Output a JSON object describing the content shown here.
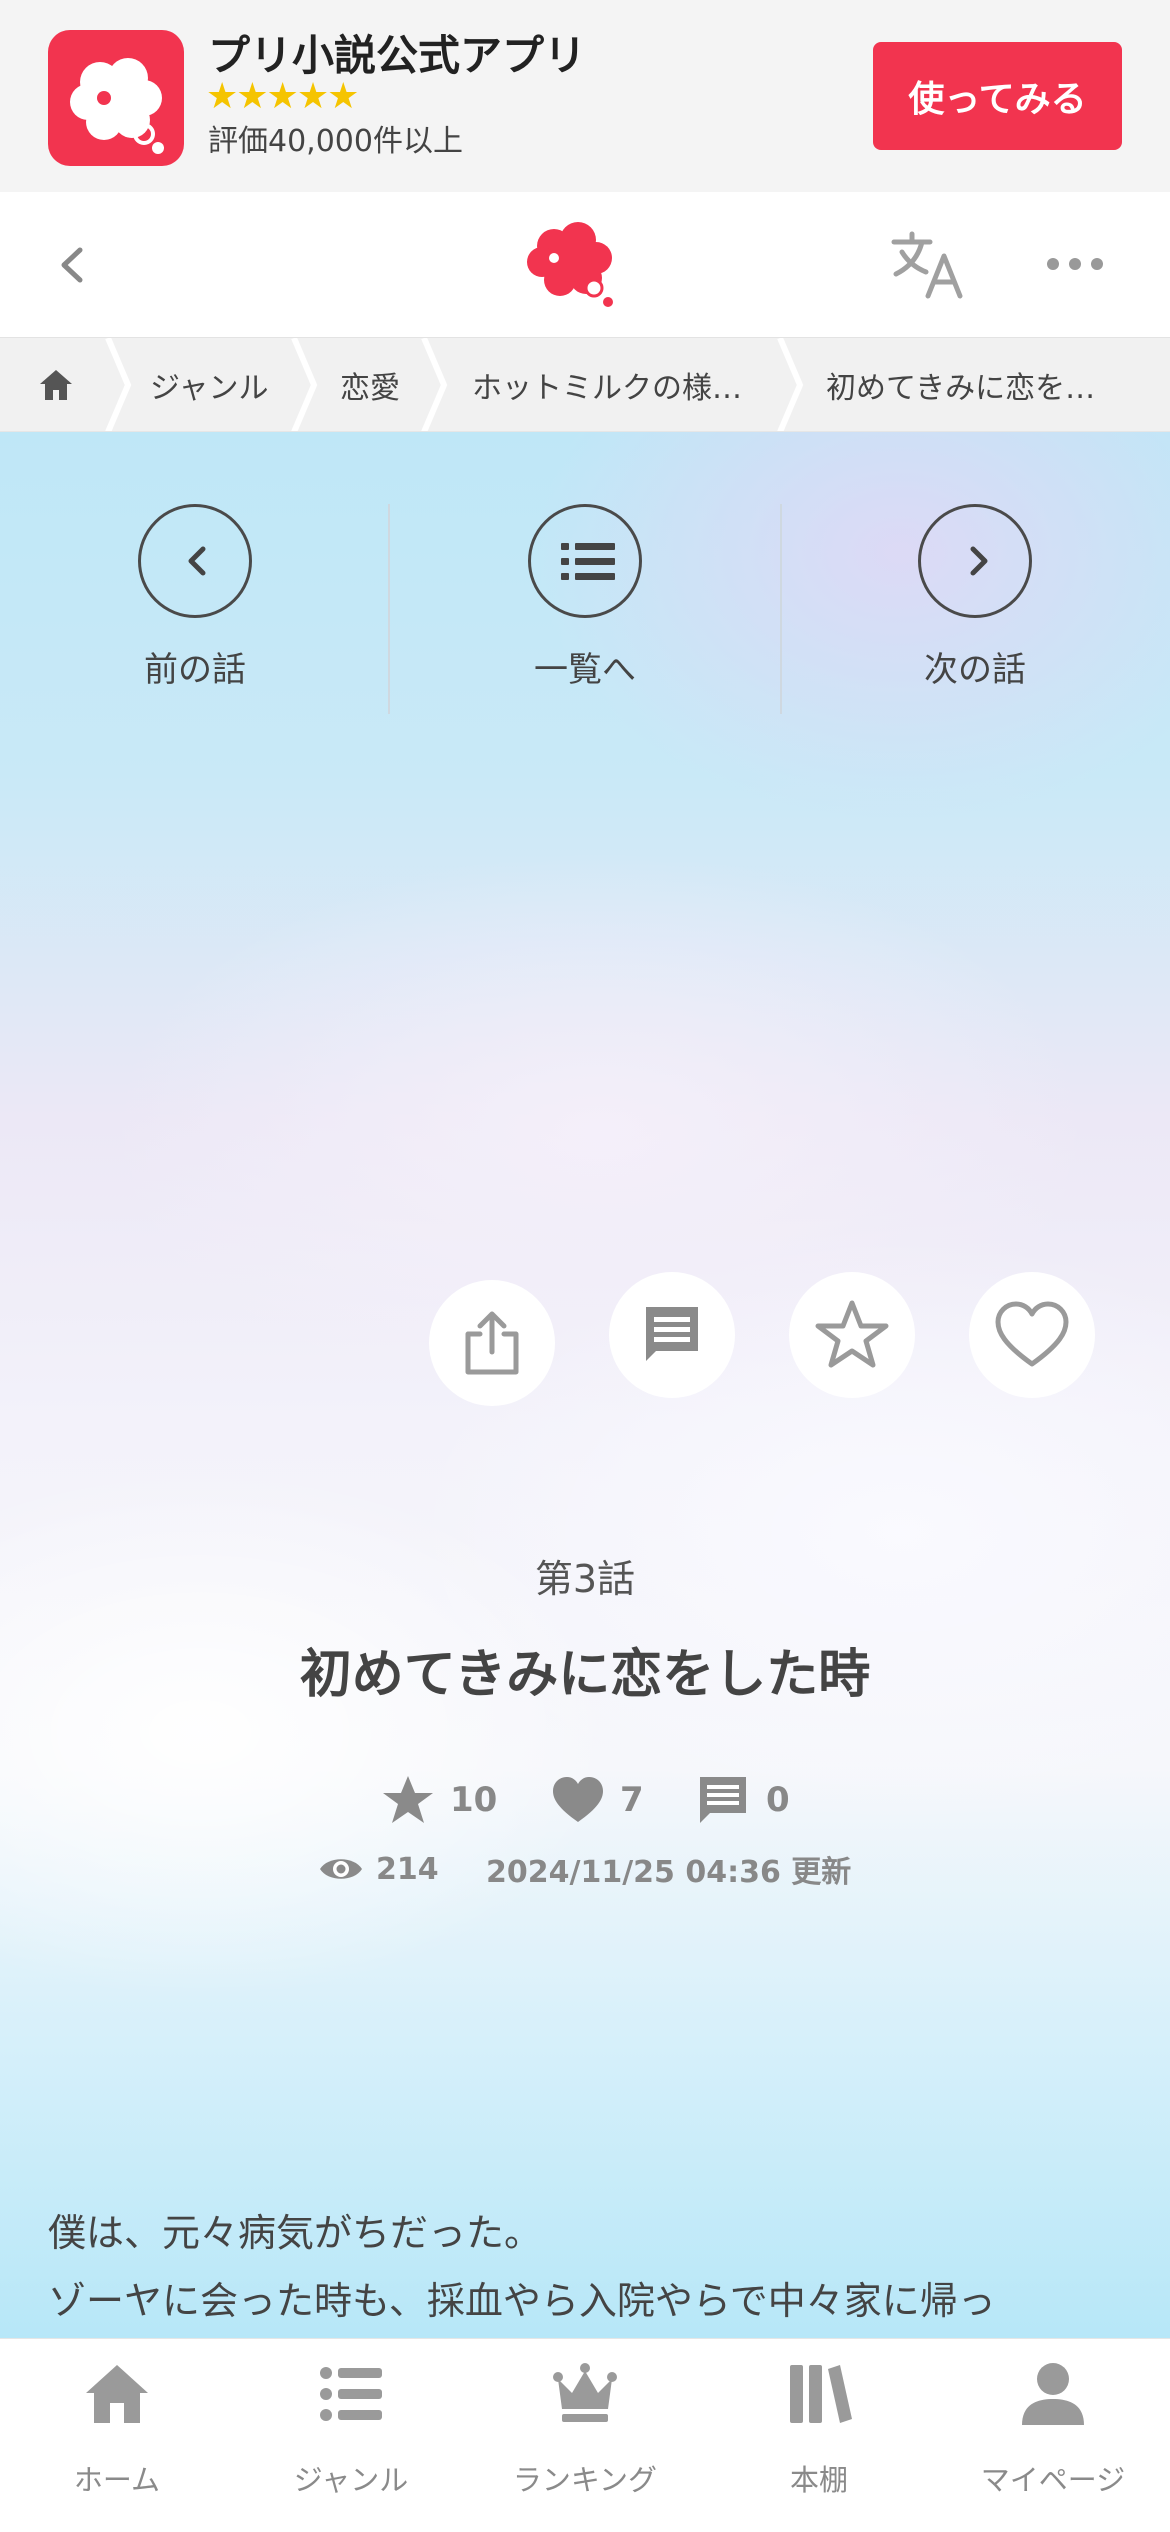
{
  "app_banner": {
    "title": "プリ小説公式アプリ",
    "stars": "★★★★★",
    "rating_text": "評価40,000件以上",
    "cta_label": "使ってみる",
    "accent_color": "#f2344f"
  },
  "header": {
    "back_icon": "chevron-left-icon",
    "logo_icon": "cloud-logo-icon",
    "translate_icon": "translate-icon",
    "more_icon": "more-horizontal-icon"
  },
  "breadcrumb": {
    "home_icon": "home-icon",
    "items": [
      "ジャンル",
      "恋愛",
      "ホットミルクの様…",
      "初めてきみに恋を…"
    ]
  },
  "episode_nav": {
    "prev_label": "前の話",
    "list_label": "一覧へ",
    "next_label": "次の話"
  },
  "actions": {
    "share_icon": "share-icon",
    "comment_icon": "comment-icon",
    "star_icon": "star-outline-icon",
    "heart_icon": "heart-outline-icon"
  },
  "episode": {
    "number": "第3話",
    "title": "初めてきみに恋をした時",
    "stars": "10",
    "hearts": "7",
    "comments": "0",
    "views": "214",
    "updated": "2024/11/25 04:36 更新"
  },
  "body": {
    "line1": "僕は、元々病気がちだった。",
    "line2": "ゾーヤに会った時も、採血やら入院やらで中々家に帰っ"
  },
  "tabbar": {
    "items": [
      {
        "label": "ホーム",
        "icon": "home-icon"
      },
      {
        "label": "ジャンル",
        "icon": "list-icon"
      },
      {
        "label": "ランキング",
        "icon": "crown-icon"
      },
      {
        "label": "本棚",
        "icon": "bookshelf-icon"
      },
      {
        "label": "マイページ",
        "icon": "user-icon"
      }
    ]
  }
}
